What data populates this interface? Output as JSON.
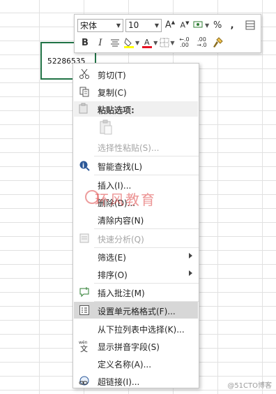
{
  "sheet": {
    "cell_value": "52286535"
  },
  "toolbar": {
    "font_name": "宋体",
    "font_size": "10",
    "percent_label": "%",
    "comma_label": ",",
    "bold_label": "B",
    "italic_label": "I",
    "increase_decimal_label": "←.0 .00",
    "decrease_decimal_label": ".00 →.0",
    "font_color": "#e81123",
    "fill_color": "#ffff00"
  },
  "menu": {
    "cut": "剪切(T)",
    "copy": "复制(C)",
    "paste_options": "粘贴选项:",
    "paste_special": "选择性粘贴(S)...",
    "smart_lookup": "智能查找(L)",
    "insert": "插入(I)...",
    "delete": "删除(D)...",
    "clear_contents": "清除内容(N)",
    "quick_analysis": "快速分析(Q)",
    "filter": "筛选(E)",
    "sort": "排序(O)",
    "insert_comment": "插入批注(M)",
    "format_cells": "设置单元格格式(F)...",
    "pick_from_list": "从下拉列表中选择(K)...",
    "show_phonetic": "显示拼音字段(S)",
    "define_name": "定义名称(A)...",
    "hyperlink": "超链接(I)..."
  },
  "watermark": {
    "text": "环风教育"
  },
  "credit": "@51CTO博客"
}
